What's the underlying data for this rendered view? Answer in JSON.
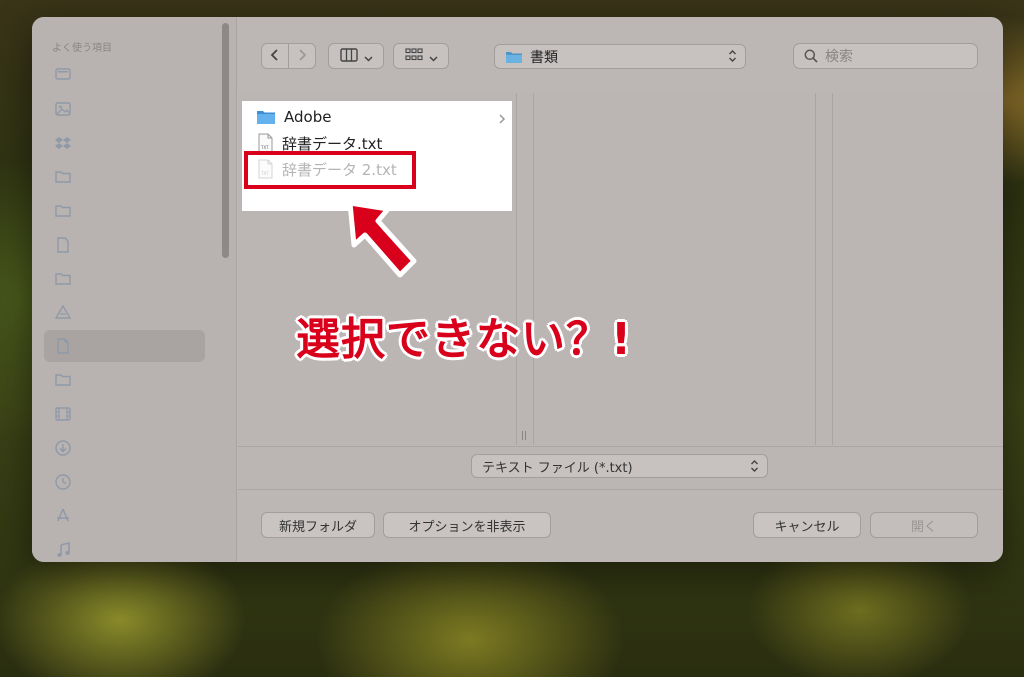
{
  "sidebar": {
    "title": "よく使う項目",
    "items": [
      {
        "icon": "monitor-icon"
      },
      {
        "icon": "photo-icon"
      },
      {
        "icon": "dropbox-icon"
      },
      {
        "icon": "folder-icon"
      },
      {
        "icon": "folder-icon"
      },
      {
        "icon": "document-icon"
      },
      {
        "icon": "folder-icon"
      },
      {
        "icon": "drive-icon"
      },
      {
        "icon": "document-icon",
        "selected": true
      },
      {
        "icon": "folder-icon"
      },
      {
        "icon": "film-icon"
      },
      {
        "icon": "download-icon"
      },
      {
        "icon": "clock-icon"
      },
      {
        "icon": "apps-icon"
      },
      {
        "icon": "music-icon"
      }
    ]
  },
  "toolbar": {
    "location": "書類",
    "search_placeholder": "検索"
  },
  "files": [
    {
      "name": "Adobe",
      "type": "folder",
      "enabled": true
    },
    {
      "name": "辞書データ.txt",
      "type": "txt",
      "enabled": true
    },
    {
      "name": "辞書データ 2.txt",
      "type": "txt",
      "enabled": false
    }
  ],
  "annotation": {
    "text": "選択できない？!",
    "color": "#d8001a"
  },
  "filter": {
    "selected": "テキスト ファイル (*.txt)"
  },
  "buttons": {
    "new_folder": "新規フォルダ",
    "hide_options": "オプションを非表示",
    "cancel": "キャンセル",
    "open": "開く"
  }
}
